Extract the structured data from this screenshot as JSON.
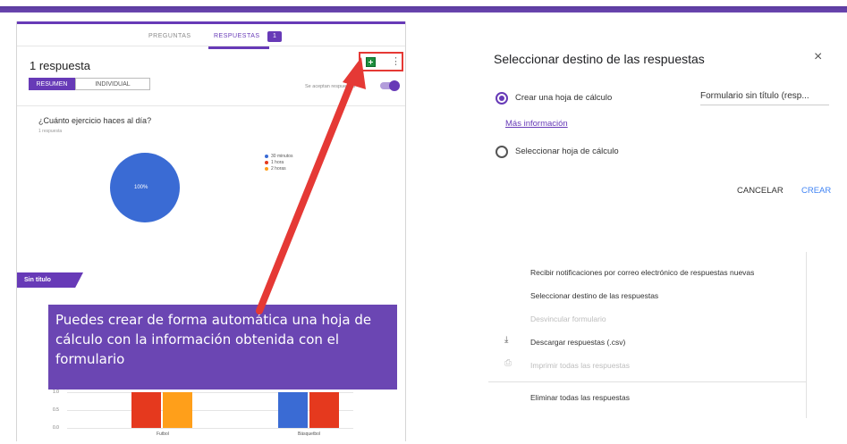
{
  "forms": {
    "tabs": {
      "preguntas": "PREGUNTAS",
      "respuestas": "RESPUESTAS",
      "badge": "1"
    },
    "response_count": "1 respuesta",
    "segments": {
      "resumen": "RESUMEN",
      "individual": "INDIVIDUAL"
    },
    "accepting": "Se aceptan respuestas",
    "question": "¿Cuánto ejercicio haces al día?",
    "question_sub": "1 respuesta",
    "pie_label": "100%",
    "section_title": "Sin título",
    "callout": "Puedes crear de forma automática una hoja de cálculo con la información obtenida con el formulario"
  },
  "chart_data": [
    {
      "type": "pie",
      "categories": [
        "30 minutos",
        "1 hora",
        "2 horas"
      ],
      "values": [
        100,
        0,
        0
      ],
      "colors": [
        "#3a6bd4",
        "#e5391e",
        "#ff9f1a"
      ],
      "data_labels": [
        "100%"
      ],
      "legend": "right"
    },
    {
      "type": "bar",
      "categories": [
        "Futbol",
        "Básquetbol"
      ],
      "series": [
        {
          "values": [
            0,
            1.0
          ],
          "color": "#3a6bd4"
        },
        {
          "values": [
            1.0,
            1.0
          ],
          "color": "#e5391e"
        },
        {
          "values": [
            1.0,
            0
          ],
          "color": "#ff9f1a"
        }
      ],
      "yticks": [
        "1.0",
        "0.5",
        "0.0"
      ],
      "ylim": [
        0,
        1.0
      ]
    }
  ],
  "dialog": {
    "title": "Seleccionar destino de las respuestas",
    "close": "×",
    "option_new": "Crear una hoja de cálculo",
    "sheet_name": "Formulario sin título (resp...",
    "more_info": "Más información",
    "option_existing": "Seleccionar hoja de cálculo",
    "cancel": "CANCELAR",
    "create": "CREAR"
  },
  "menu": {
    "items": [
      "Recibir notificaciones por correo electrónico de respuestas nuevas",
      "Seleccionar destino de las respuestas",
      "Desvincular formulario",
      "Descargar respuestas (.csv)",
      "Imprimir todas las respuestas",
      "Eliminar todas las respuestas"
    ]
  },
  "colors": {
    "accent": "#673ab7",
    "arrow": "#e53935",
    "sheets": "#1e8e3e"
  },
  "icons": [
    "spreadsheet-icon",
    "more-vert-icon",
    "close-icon",
    "download-icon",
    "print-icon"
  ]
}
